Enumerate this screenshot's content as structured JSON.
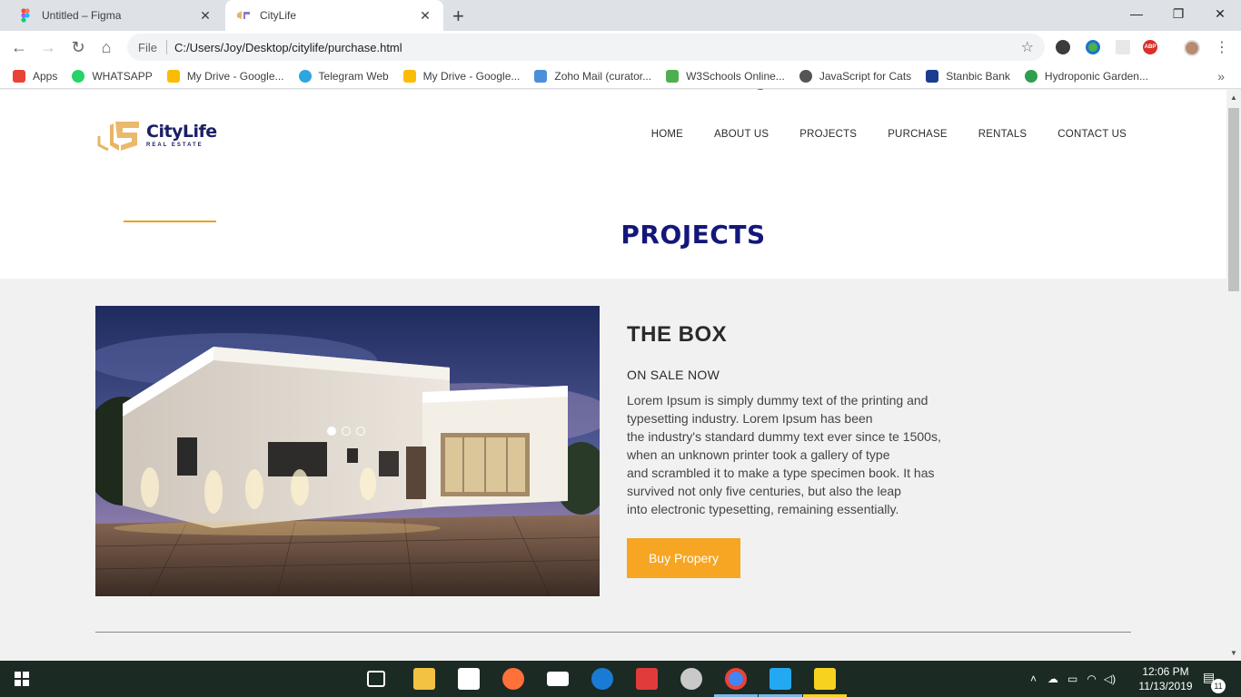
{
  "browser": {
    "tabs": [
      {
        "title": "Untitled – Figma",
        "active": false
      },
      {
        "title": "CityLife",
        "active": true
      }
    ],
    "address": {
      "scheme": "File",
      "url": "C:/Users/Joy/Desktop/citylife/purchase.html"
    },
    "bookmarks": [
      {
        "label": "Apps",
        "icon": "apps-grid-icon",
        "color": "#e94335"
      },
      {
        "label": "WHATSAPP",
        "icon": "whatsapp-icon",
        "color": "#25d366"
      },
      {
        "label": "My Drive - Google...",
        "icon": "google-drive-icon",
        "color": "#fbbc04"
      },
      {
        "label": "Telegram Web",
        "icon": "telegram-icon",
        "color": "#2ca5e0"
      },
      {
        "label": "My Drive - Google...",
        "icon": "google-drive-icon",
        "color": "#fbbc04"
      },
      {
        "label": "Zoho Mail (curator...",
        "icon": "zoho-mail-icon",
        "color": "#4a90d9"
      },
      {
        "label": "W3Schools Online...",
        "icon": "w3schools-icon",
        "color": "#4caf50"
      },
      {
        "label": "JavaScript for Cats",
        "icon": "globe-icon",
        "color": "#555555"
      },
      {
        "label": "Stanbic Bank",
        "icon": "shield-icon",
        "color": "#1b3d8f"
      },
      {
        "label": "Hydroponic Garden...",
        "icon": "leaf-icon",
        "color": "#2e9e4f"
      }
    ]
  },
  "site": {
    "brand": {
      "name": "CityLife",
      "sub": "REAL ESTATE"
    },
    "nav": [
      "HOME",
      "ABOUT US",
      "PROJECTS",
      "PURCHASE",
      "RENTALS",
      "CONTACT US"
    ],
    "page_title": "PROJECTS",
    "project": {
      "name": "THE BOX",
      "status": "ON SALE NOW",
      "description_lines": [
        "Lorem Ipsum is simply dummy text of the printing and",
        "typesetting industry. Lorem Ipsum has been",
        "the industry's standard dummy text ever since te 1500s,",
        "when an unknown printer took a gallery of type",
        "and scrambled it to make a type specimen book. It has",
        "survived not only five centuries, but also the leap",
        "into electronic typesetting, remaining essentially."
      ],
      "button": "Buy Propery",
      "carousel": {
        "slides": 3,
        "active": 1
      }
    }
  },
  "taskbar": {
    "time": "12:06 PM",
    "date": "11/13/2019",
    "notifications": "11"
  },
  "colors": {
    "brand_navy": "#14177a",
    "accent_orange": "#f6a623",
    "logo_gold": "#e9b564"
  }
}
